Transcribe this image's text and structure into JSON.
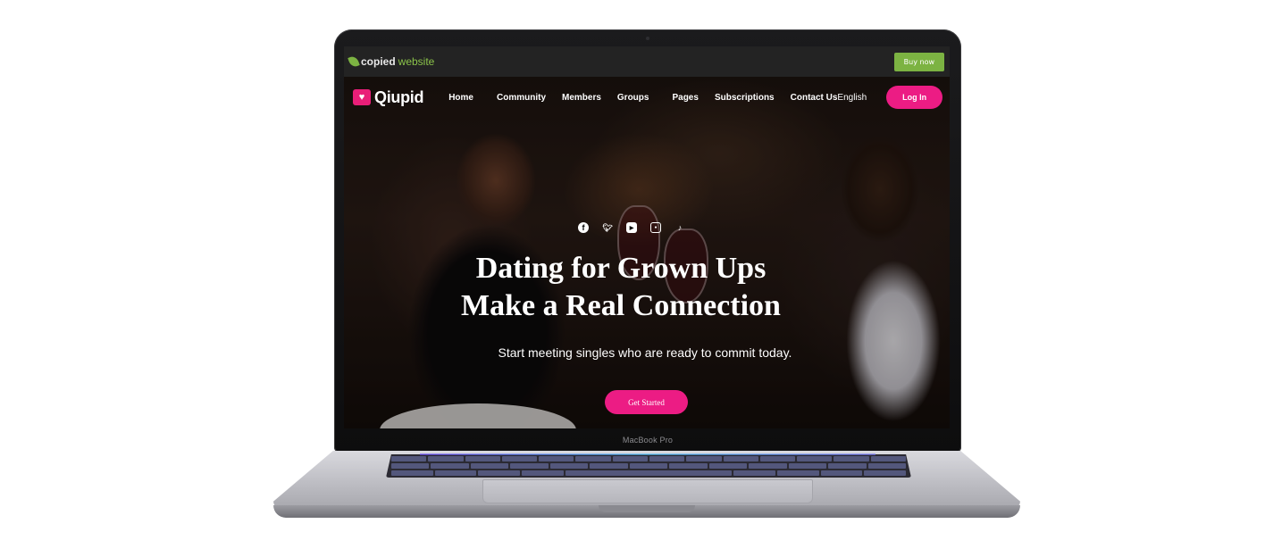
{
  "device": {
    "model_label": "MacBook Pro"
  },
  "topbar": {
    "logo_copied": "copied",
    "logo_website": "website",
    "buy_now_label": "Buy now",
    "accent_color": "#7cb342"
  },
  "nav": {
    "brand": "Qiupid",
    "links": [
      "Home",
      "Community",
      "Members",
      "Groups",
      "Pages",
      "Subscriptions",
      "Contact Us"
    ],
    "language": "English",
    "login_label": "Log In",
    "brand_color": "#ec1c84"
  },
  "hero": {
    "socials": [
      "facebook-icon",
      "twitter-icon",
      "youtube-icon",
      "instagram-icon",
      "tiktok-icon"
    ],
    "headline_line1": "Dating for Grown Ups",
    "headline_line2": "Make a Real Connection",
    "subline": "Start meeting singles who are ready to commit today.",
    "cta_label": "Get Started"
  }
}
